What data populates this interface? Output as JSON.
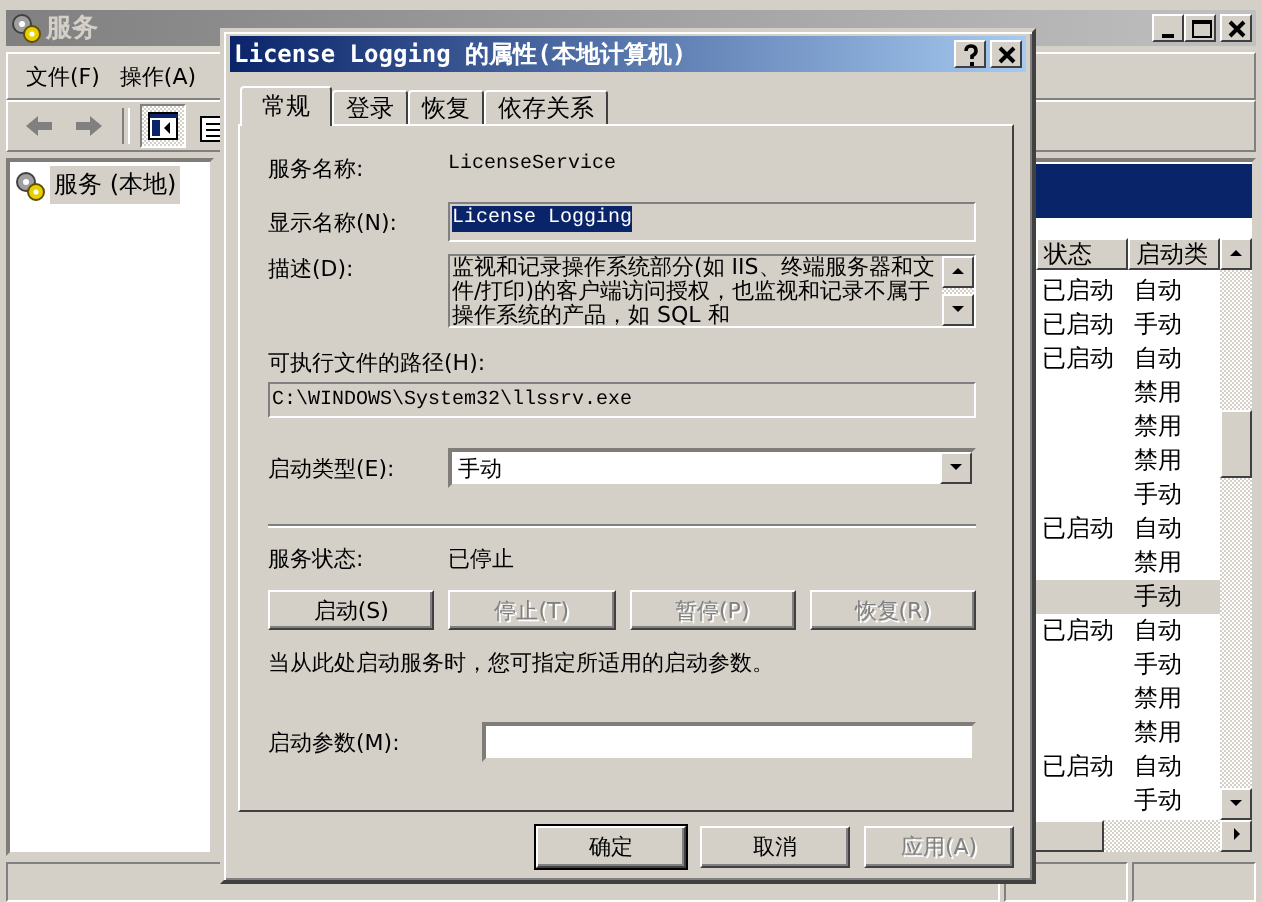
{
  "main_window": {
    "title": "服务",
    "menu": [
      {
        "label": "文件(F)"
      },
      {
        "label": "操作(A)"
      }
    ],
    "toolbar": [
      {
        "kind": "back",
        "disabled": true
      },
      {
        "kind": "forward",
        "disabled": true
      },
      {
        "kind": "tree_toggle",
        "pressed": true
      },
      {
        "kind": "properties",
        "pressed": false
      }
    ],
    "tree": [
      {
        "label": "服务 (本地)",
        "selected": true
      }
    ],
    "list": {
      "columns": [
        "状态",
        "启动类"
      ],
      "rows": [
        {
          "status": "已启动",
          "startup": "自动",
          "selected": false
        },
        {
          "status": "已启动",
          "startup": "手动",
          "selected": false
        },
        {
          "status": "已启动",
          "startup": "自动",
          "selected": false
        },
        {
          "startup": "禁用",
          "selected": false
        },
        {
          "startup": "禁用",
          "selected": false
        },
        {
          "startup": "禁用",
          "selected": false
        },
        {
          "startup": "手动",
          "selected": false
        },
        {
          "status": "已启动",
          "startup": "自动",
          "selected": false
        },
        {
          "startup": "禁用",
          "selected": false
        },
        {
          "startup": "手动",
          "selected": true
        },
        {
          "status": "已启动",
          "startup": "自动",
          "selected": false
        },
        {
          "startup": "手动",
          "selected": false
        },
        {
          "startup": "禁用",
          "selected": false
        },
        {
          "startup": "禁用",
          "selected": false
        },
        {
          "status": "已启动",
          "startup": "自动",
          "selected": false
        },
        {
          "startup": "手动",
          "selected": false
        }
      ]
    }
  },
  "dialog": {
    "title": "License Logging 的属性(本地计算机)",
    "tabs": [
      {
        "label": "常规",
        "selected": true
      },
      {
        "label": "登录",
        "selected": false
      },
      {
        "label": "恢复",
        "selected": false
      },
      {
        "label": "依存关系",
        "selected": false
      }
    ],
    "service_name": {
      "label": "服务名称:",
      "value": "LicenseService"
    },
    "display_name": {
      "label": "显示名称(N):",
      "value": "License Logging",
      "text_selected": true
    },
    "description": {
      "label": "描述(D):",
      "value": "监视和记录操作系统部分(如 IIS、终端服务器和文件/打印)的客户端访问授权，也监视和记录不属于操作系统的产品，如 SQL 和"
    },
    "path": {
      "label": "可执行文件的路径(H):",
      "value": "C:\\WINDOWS\\System32\\llssrv.exe"
    },
    "startup_type": {
      "label": "启动类型(E):",
      "value": "手动"
    },
    "service_status": {
      "label": "服务状态:",
      "value": "已停止"
    },
    "service_buttons": [
      {
        "label": "启动(S)",
        "disabled": false
      },
      {
        "label": "停止(T)",
        "disabled": true
      },
      {
        "label": "暂停(P)",
        "disabled": true
      },
      {
        "label": "恢复(R)",
        "disabled": true
      }
    ],
    "hint": "当从此处启动服务时，您可指定所适用的启动参数。",
    "start_parameters": {
      "label": "启动参数(M):"
    },
    "buttons": [
      {
        "label": "确定",
        "disabled": false,
        "default": true
      },
      {
        "label": "取消",
        "disabled": false,
        "default": false
      },
      {
        "label": "应用(A)",
        "disabled": true,
        "default": false
      }
    ]
  }
}
